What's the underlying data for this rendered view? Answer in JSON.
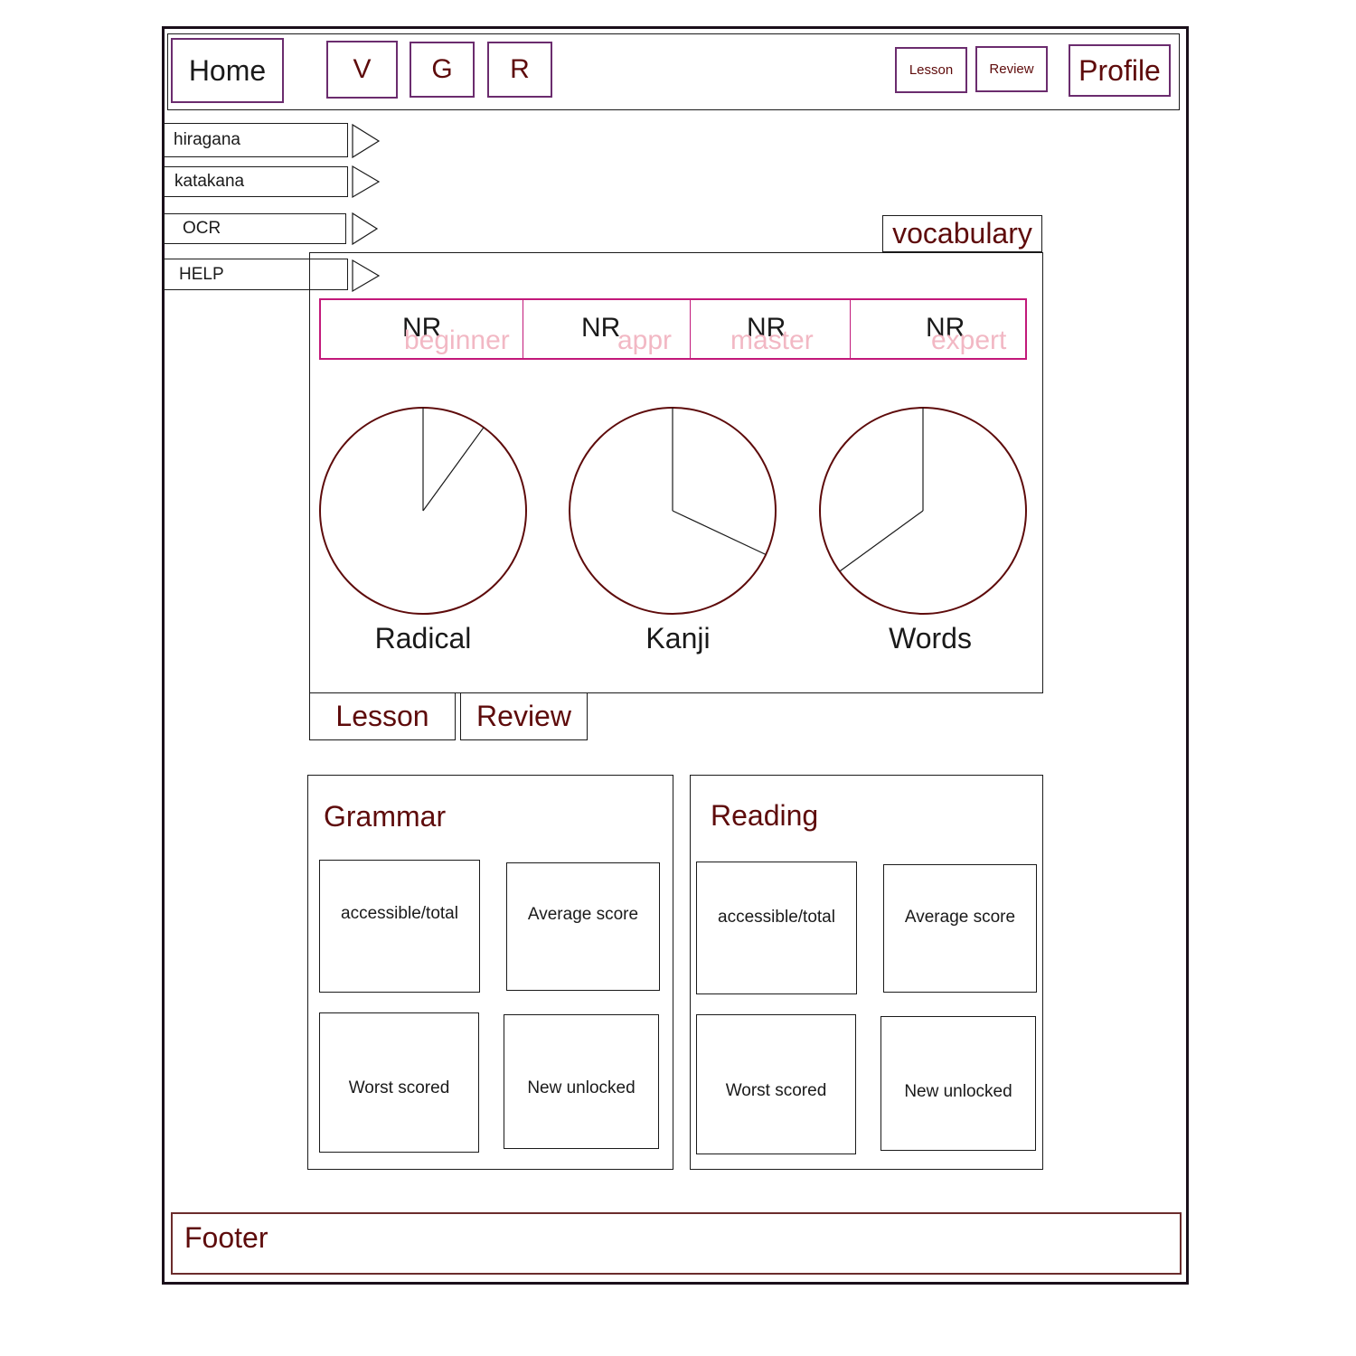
{
  "header": {
    "home": "Home",
    "nav": [
      "V",
      "G",
      "R"
    ],
    "lesson_small": "Lesson",
    "review_small": "Review",
    "profile": "Profile"
  },
  "sidebar": {
    "items": [
      {
        "label": "hiragana"
      },
      {
        "label": "katakana"
      },
      {
        "label": "OCR"
      },
      {
        "label": "HELP"
      }
    ]
  },
  "vocabulary": {
    "title": "vocabulary",
    "levels": [
      {
        "value": "NR",
        "label": "beginner"
      },
      {
        "value": "NR",
        "label": "appr"
      },
      {
        "value": "NR",
        "label": "master"
      },
      {
        "value": "NR",
        "label": "expert"
      }
    ],
    "lesson_button": "Lesson",
    "review_button": "Review"
  },
  "chart_data": {
    "type": "pie",
    "charts": [
      {
        "label": "Radical",
        "slice_fraction": 0.1
      },
      {
        "label": "Kanji",
        "slice_fraction": 0.32
      },
      {
        "label": "Words",
        "slice_fraction": 0.65
      }
    ]
  },
  "grammar": {
    "title": "Grammar",
    "cards": [
      "accessible/total",
      "Average score",
      "Worst scored",
      "New unlocked"
    ]
  },
  "reading": {
    "title": "Reading",
    "cards": [
      "accessible/total",
      "Average score",
      "Worst scored",
      "New unlocked"
    ]
  },
  "footer": {
    "label": "Footer"
  },
  "colors": {
    "accent": "#5e0b0b",
    "frame": "#6b2c6e",
    "tab_border": "#c2197a",
    "level_text": "#f2b8c4"
  }
}
